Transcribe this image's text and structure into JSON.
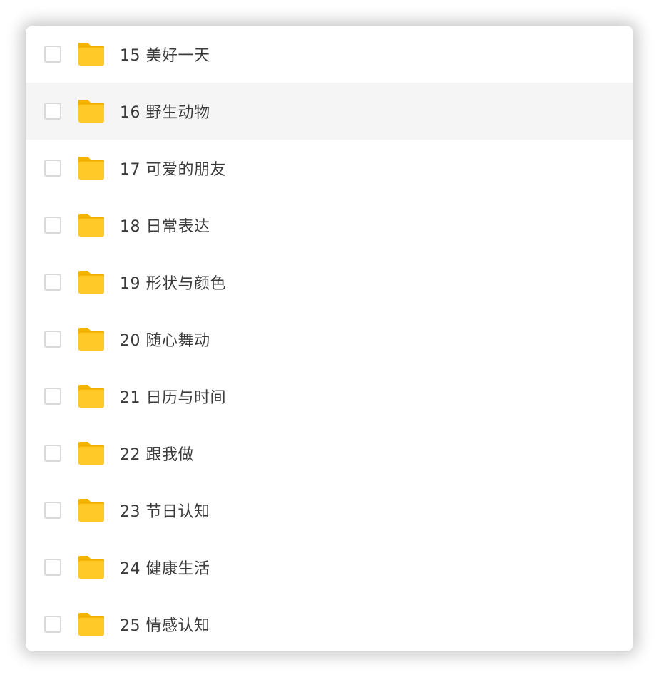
{
  "colors": {
    "folder_body": "#FFC928",
    "folder_tab": "#F5B300",
    "row_hover_bg": "#F5F5F5",
    "text": "#3B3B3B",
    "checkbox_border": "#D9D9D9"
  },
  "icon_names": {
    "folder": "folder-icon",
    "checkbox": "checkbox"
  },
  "folders": [
    {
      "label": "15 美好一天",
      "selected": false
    },
    {
      "label": "16 野生动物",
      "selected": false,
      "hovered": true
    },
    {
      "label": "17 可爱的朋友",
      "selected": false
    },
    {
      "label": "18 日常表达",
      "selected": false
    },
    {
      "label": "19 形状与颜色",
      "selected": false
    },
    {
      "label": "20 随心舞动",
      "selected": false
    },
    {
      "label": "21 日历与时间",
      "selected": false
    },
    {
      "label": "22 跟我做",
      "selected": false
    },
    {
      "label": "23 节日认知",
      "selected": false
    },
    {
      "label": "24 健康生活",
      "selected": false
    },
    {
      "label": "25 情感认知",
      "selected": false
    }
  ]
}
